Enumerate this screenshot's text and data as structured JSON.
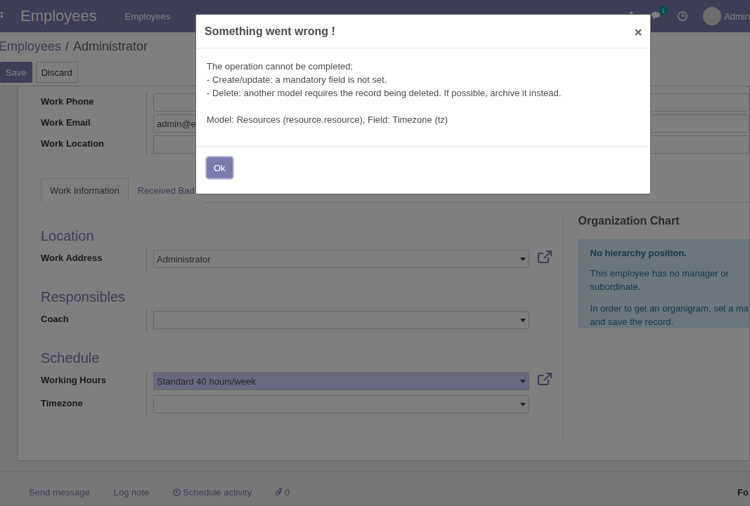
{
  "navbar": {
    "app_name": "Employees",
    "menu": [
      "Employees"
    ],
    "chat_badge": "1",
    "user": "Admin"
  },
  "breadcrumb": [
    "Employees",
    "/",
    "Administrator"
  ],
  "buttons": [
    {
      "label": "Save",
      "kind": "primary"
    },
    {
      "label": "Discard",
      "kind": "secondary"
    }
  ],
  "top_fields": [
    {
      "label": "Work Phone"
    },
    {
      "label": "Work Email",
      "value": "admin@e"
    },
    {
      "label": "Work Location"
    }
  ],
  "tabs": [
    {
      "label": "Work Information",
      "selected": true
    },
    {
      "label": "Received Bad",
      "selected": false
    }
  ],
  "sections": [
    {
      "title": "Location",
      "fields": [
        {
          "label": "Work Address",
          "value": "Administrator",
          "highlighted": false,
          "external_link": true
        }
      ]
    },
    {
      "title": "Responsibles",
      "fields": [
        {
          "label": "Coach",
          "highlighted": false,
          "external_link": false
        }
      ]
    },
    {
      "title": "Schedule",
      "fields": [
        {
          "label": "Working Hours",
          "value": "Standard 40 hours/week",
          "highlighted": true,
          "external_link": true
        },
        {
          "label": "Timezone",
          "highlighted": false,
          "external_link": false
        }
      ]
    }
  ],
  "org_chart": {
    "title": "Organization Chart",
    "heading": "No hierarchy position.",
    "paragraphs": [
      [
        "This employee has no manager or",
        "subordinate."
      ],
      [
        "In order to get an organigram, set a ma",
        "and save the record."
      ]
    ]
  },
  "chatter": {
    "actions": [
      {
        "label": "Send message",
        "kind": "text"
      },
      {
        "label": "Log note",
        "kind": "text"
      },
      {
        "label": "Schedule activity",
        "kind": "clock"
      },
      {
        "label": "0",
        "kind": "paperclip"
      }
    ],
    "follow": "Fo"
  },
  "dialog": {
    "title": "Something went wrong !",
    "paragraphs": [
      [
        "The operation cannot be completed:",
        "- Create/update: a mandatory field is not set.",
        "- Delete: another model requires the record being deleted. If possible, archive it instead."
      ],
      [
        "Model: Resources (resource.resource), Field: Timezone (tz)"
      ]
    ],
    "button": "Ok"
  }
}
